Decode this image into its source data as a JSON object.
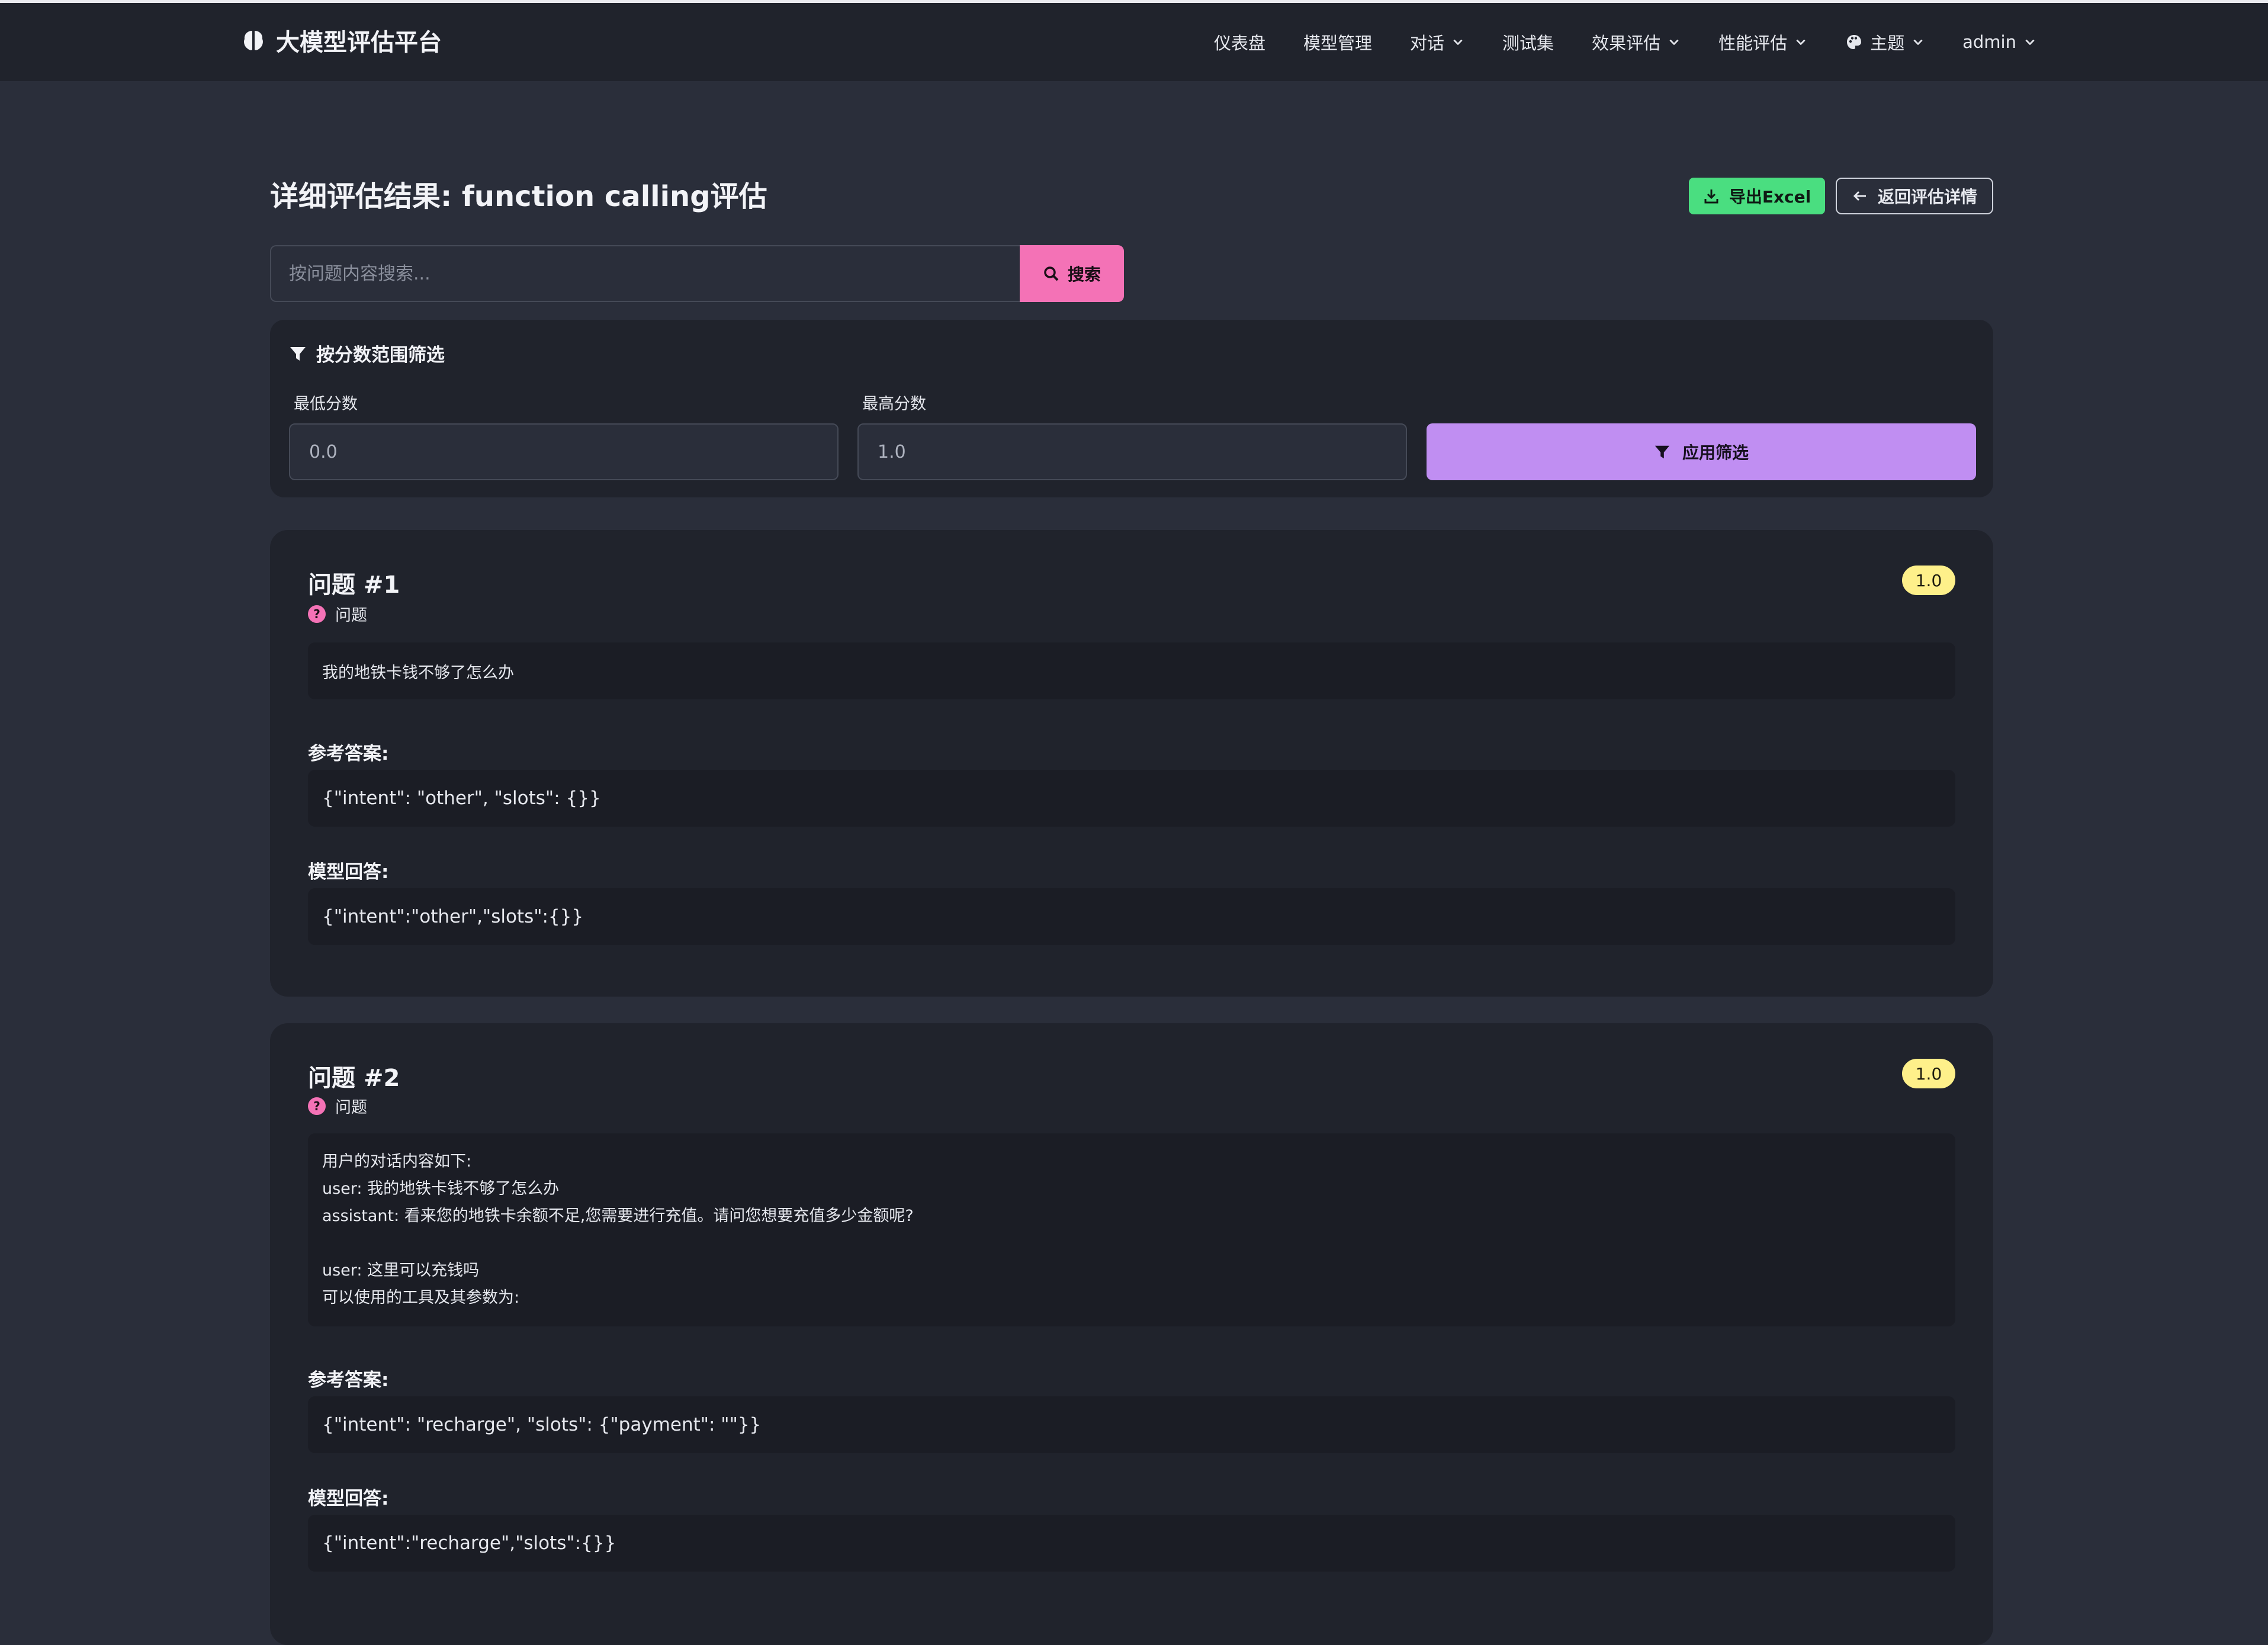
{
  "app": {
    "title": "大模型评估平台"
  },
  "nav": {
    "items": [
      {
        "label": "仪表盘",
        "dropdown": false
      },
      {
        "label": "模型管理",
        "dropdown": false
      },
      {
        "label": "对话",
        "dropdown": true
      },
      {
        "label": "测试集",
        "dropdown": false
      },
      {
        "label": "效果评估",
        "dropdown": true
      },
      {
        "label": "性能评估",
        "dropdown": true
      },
      {
        "label": "主题",
        "dropdown": true,
        "icon": "palette-icon"
      },
      {
        "label": "admin",
        "dropdown": true
      }
    ]
  },
  "page": {
    "title": "详细评估结果: function calling评估",
    "export_label": "导出Excel",
    "back_label": "返回评估详情"
  },
  "search": {
    "placeholder": "按问题内容搜索...",
    "button_label": "搜索"
  },
  "filter": {
    "title": "按分数范围筛选",
    "min_label": "最低分数",
    "min_value": "0.0",
    "max_label": "最高分数",
    "max_value": "1.0",
    "apply_label": "应用筛选"
  },
  "labels": {
    "question": "问题",
    "reference": "参考答案:",
    "model_answer": "模型回答:"
  },
  "questions": [
    {
      "title": "问题 #1",
      "score": "1.0",
      "question_lines": [
        "我的地铁卡钱不够了怎么办"
      ],
      "reference": "{\"intent\": \"other\", \"slots\": {}}",
      "answer": "{\"intent\":\"other\",\"slots\":{}}"
    },
    {
      "title": "问题 #2",
      "score": "1.0",
      "question_lines": [
        "用户的对话内容如下:",
        "user: 我的地铁卡钱不够了怎么办",
        "assistant: 看来您的地铁卡余额不足,您需要进行充值。请问您想要充值多少金额呢?",
        "",
        "user: 这里可以充钱吗",
        "可以使用的工具及其参数为:"
      ],
      "reference": "{\"intent\": \"recharge\", \"slots\": {\"payment\": \"\"}}",
      "answer": "{\"intent\":\"recharge\",\"slots\":{}}"
    }
  ],
  "colors": {
    "background": "#2a2e3a",
    "navbar": "#20232c",
    "card": "#20232c",
    "export_button": "#4ade80",
    "search_button": "#f472b6",
    "apply_button": "#c08ef2",
    "score_badge": "#fef08a"
  }
}
